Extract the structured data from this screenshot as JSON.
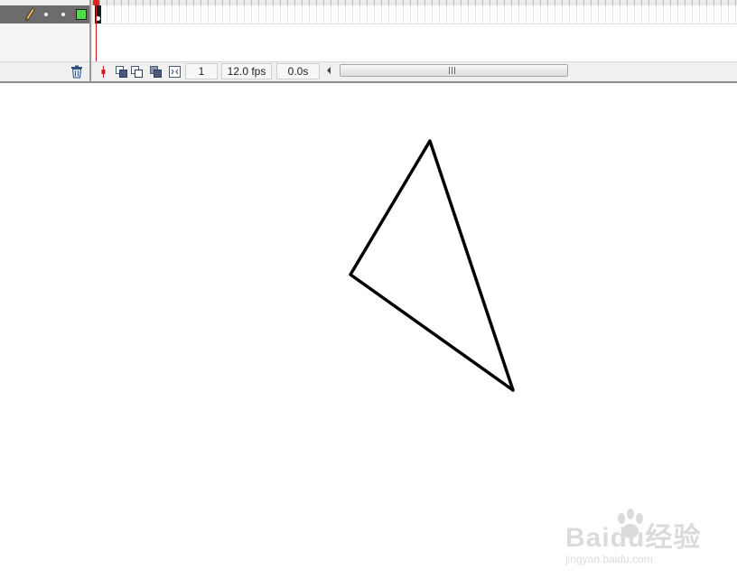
{
  "timeline": {
    "current_frame": "1",
    "frame_rate": "12.0 fps",
    "elapsed_time": "0.0s",
    "layer_outline_color": "#4cdc4c",
    "playhead_color": "#cc1b1b"
  },
  "icons": {
    "layer_edit": "pencil-icon",
    "delete_layer": "trash-icon",
    "center_frame": "center-frame-icon",
    "onion_skin": "onion-skin-icon",
    "onion_skin_outlines": "onion-skin-outlines-icon",
    "edit_multiple_frames": "edit-multiple-frames-icon",
    "modify_onion_markers": "modify-onion-markers-icon"
  },
  "watermark": {
    "brand": "Baidu经验",
    "url": "jingyan.baidu.com"
  }
}
